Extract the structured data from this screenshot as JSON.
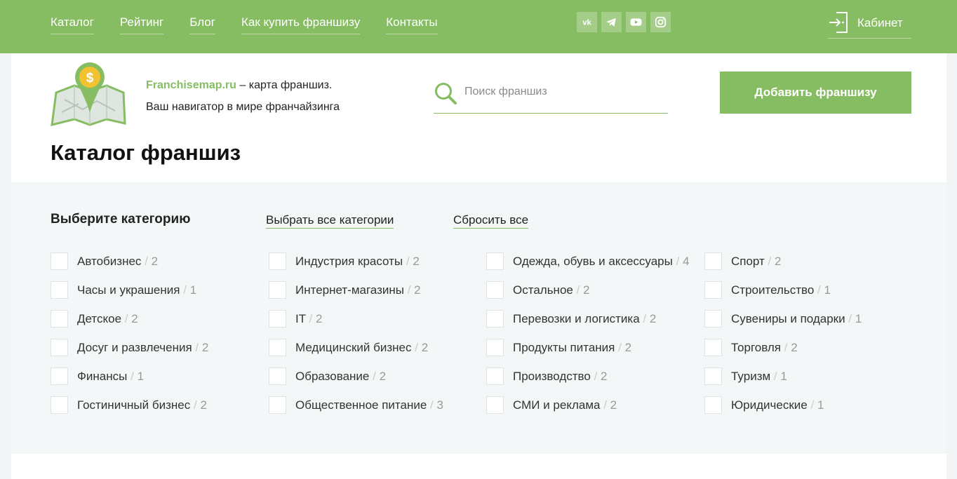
{
  "nav": [
    {
      "label": "Каталог"
    },
    {
      "label": "Рейтинг"
    },
    {
      "label": "Блог"
    },
    {
      "label": "Как купить франшизу"
    },
    {
      "label": "Контакты"
    }
  ],
  "socials": [
    "vk-icon",
    "telegram-icon",
    "youtube-icon",
    "instagram-icon"
  ],
  "cabinet": {
    "label": "Кабинет",
    "icon": "login-door-icon"
  },
  "brand": {
    "name": "Franchisemap.ru",
    "line1_rest": " – карта франшиз.",
    "line2": "Ваш навигатор в мире франчайзинга",
    "logo_icon": "map-coin-pin-logo"
  },
  "search": {
    "placeholder": "Поиск франшиз",
    "value": ""
  },
  "add_button": "Добавить франшизу",
  "page_title": "Каталог франшиз",
  "filter": {
    "heading": "Выберите категорию",
    "select_all": "Выбрать все категории",
    "reset_all": "Сбросить все",
    "columns": [
      [
        {
          "name": "Автобизнес",
          "count": "2"
        },
        {
          "name": "Часы и украшения",
          "count": "1"
        },
        {
          "name": "Детское",
          "count": "2"
        },
        {
          "name": "Досуг и развлечения",
          "count": "2"
        },
        {
          "name": "Финансы",
          "count": "1"
        },
        {
          "name": "Гостиничный бизнес",
          "count": "2"
        }
      ],
      [
        {
          "name": "Индустрия красоты",
          "count": "2"
        },
        {
          "name": "Интернет-магазины",
          "count": "2"
        },
        {
          "name": "IT",
          "count": "2"
        },
        {
          "name": "Медицинский бизнес",
          "count": "2"
        },
        {
          "name": "Образование",
          "count": "2"
        },
        {
          "name": "Общественное питание",
          "count": "3"
        }
      ],
      [
        {
          "name": "Одежда, обувь и аксессуары",
          "count": "4"
        },
        {
          "name": "Остальное",
          "count": "2"
        },
        {
          "name": "Перевозки и логистика",
          "count": "2"
        },
        {
          "name": "Продукты питания",
          "count": "2"
        },
        {
          "name": "Производство",
          "count": "2"
        },
        {
          "name": "СМИ и реклама",
          "count": "2"
        }
      ],
      [
        {
          "name": "Спорт",
          "count": "2"
        },
        {
          "name": "Строительство",
          "count": "1"
        },
        {
          "name": "Сувениры и подарки",
          "count": "1"
        },
        {
          "name": "Торговля",
          "count": "2"
        },
        {
          "name": "Туризм",
          "count": "1"
        },
        {
          "name": "Юридические",
          "count": "1"
        }
      ]
    ]
  },
  "colors": {
    "brand_green": "#86bd63",
    "filter_bg": "#f4f7f8"
  }
}
